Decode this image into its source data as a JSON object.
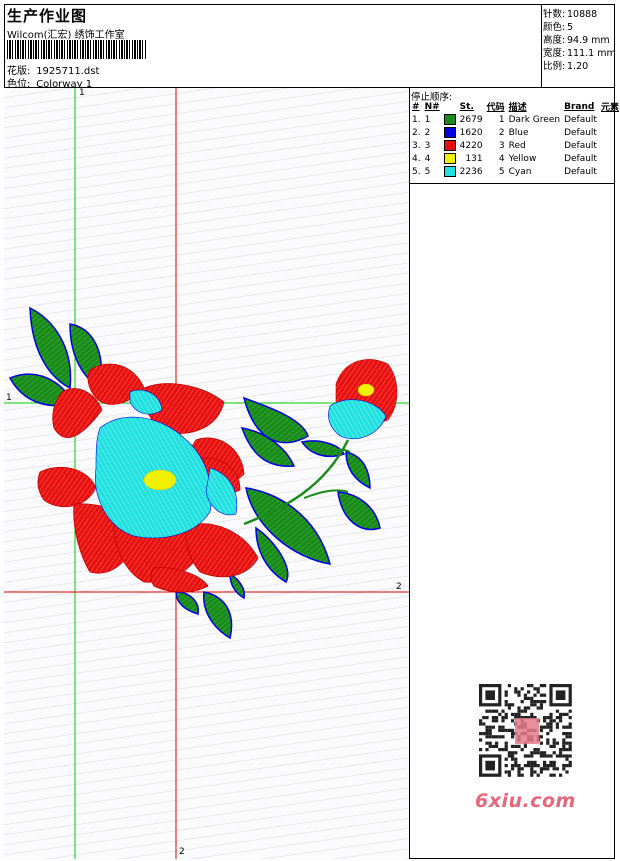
{
  "header": {
    "title": "生产作业图",
    "studio": "Wilcom(汇宏) 绣饰工作室",
    "design_label": "花版:",
    "design_file": "1925711.dst",
    "colorway_label": "色位:",
    "colorway": "Colorway 1"
  },
  "stats": [
    {
      "label": "针数:",
      "value": "10888"
    },
    {
      "label": "颜色:",
      "value": "5"
    },
    {
      "label": "高度:",
      "value": "94.9 mm"
    },
    {
      "label": "宽度:",
      "value": "111.1 mm"
    },
    {
      "label": "比例:",
      "value": "1.20"
    }
  ],
  "thread_panel": {
    "title": "停止顺序:",
    "columns": [
      "#",
      "N#",
      "St.",
      "代码",
      "描述",
      "Brand",
      "元素"
    ],
    "rows": [
      {
        "order": "1.",
        "needle": "1",
        "color": "#1a8a1a",
        "stitches": "2679",
        "code": "1",
        "desc": "Dark Green",
        "brand": "Default"
      },
      {
        "order": "2.",
        "needle": "2",
        "color": "#0000e0",
        "stitches": "1620",
        "code": "2",
        "desc": "Blue",
        "brand": "Default"
      },
      {
        "order": "3.",
        "needle": "3",
        "color": "#e81010",
        "stitches": "4220",
        "code": "3",
        "desc": "Red",
        "brand": "Default"
      },
      {
        "order": "4.",
        "needle": "4",
        "color": "#f0f000",
        "stitches": "131",
        "code": "4",
        "desc": "Yellow",
        "brand": "Default"
      },
      {
        "order": "5.",
        "needle": "5",
        "color": "#20e0e0",
        "stitches": "2236",
        "code": "5",
        "desc": "Cyan",
        "brand": "Default"
      }
    ]
  },
  "guides": {
    "top_1": "1",
    "left_1": "1",
    "right_2": "2",
    "bottom_2": "2"
  },
  "watermark": "6xiu.com",
  "colors": {
    "green": "#1a8a1a",
    "blue": "#0000e0",
    "red": "#e81010",
    "yellow": "#f0f000",
    "cyan": "#20e0e0",
    "guide_green": "#00cc00",
    "guide_red": "#dd0000"
  }
}
